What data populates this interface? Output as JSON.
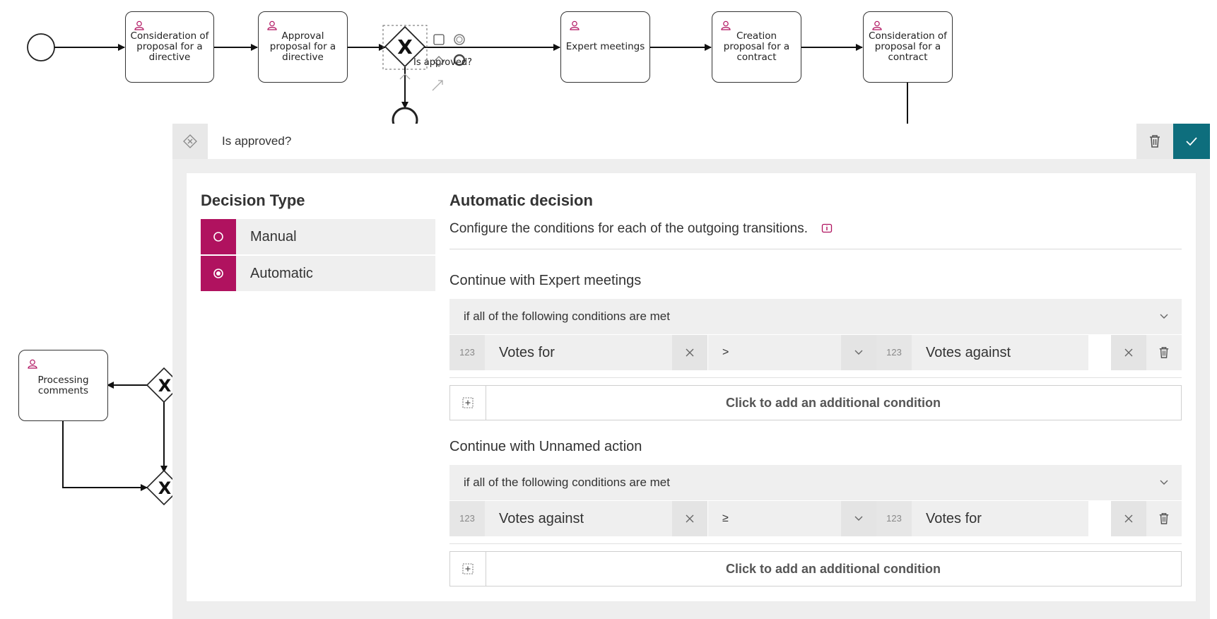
{
  "diagram": {
    "tasks": [
      {
        "id": "t1",
        "label": "Consideration of proposal for a directive"
      },
      {
        "id": "t2",
        "label": "Approval proposal for a directive"
      },
      {
        "id": "t3",
        "label": "Expert meetings"
      },
      {
        "id": "t4",
        "label": "Creation proposal for a contract"
      },
      {
        "id": "t5",
        "label": "Consideration of proposal for a contract"
      },
      {
        "id": "t6",
        "label": "Processing comments"
      }
    ],
    "gateway_label": "Is approved?"
  },
  "header": {
    "name_value": "Is approved?",
    "delete_icon": "trash-icon",
    "confirm_icon": "check-icon"
  },
  "decision_type": {
    "title": "Decision Type",
    "options": [
      {
        "label": "Manual",
        "selected": false
      },
      {
        "label": "Automatic",
        "selected": true
      }
    ]
  },
  "automatic": {
    "title": "Automatic decision",
    "description": "Configure the conditions for each of the outgoing transitions.",
    "transitions": [
      {
        "title": "Continue with Expert meetings",
        "mode": "if all of the following conditions are met",
        "condition": {
          "left_type": "123",
          "left": "Votes for",
          "operator": ">",
          "right_type": "123",
          "right": "Votes against"
        },
        "add_label": "Click to add an additional condition"
      },
      {
        "title": "Continue with Unnamed action",
        "mode": "if all of the following conditions are met",
        "condition": {
          "left_type": "123",
          "left": "Votes against",
          "operator": "≥",
          "right_type": "123",
          "right": "Votes for"
        },
        "add_label": "Click to add an additional condition"
      }
    ]
  },
  "colors": {
    "accent": "#b0125f",
    "confirm": "#0e6e7d"
  }
}
